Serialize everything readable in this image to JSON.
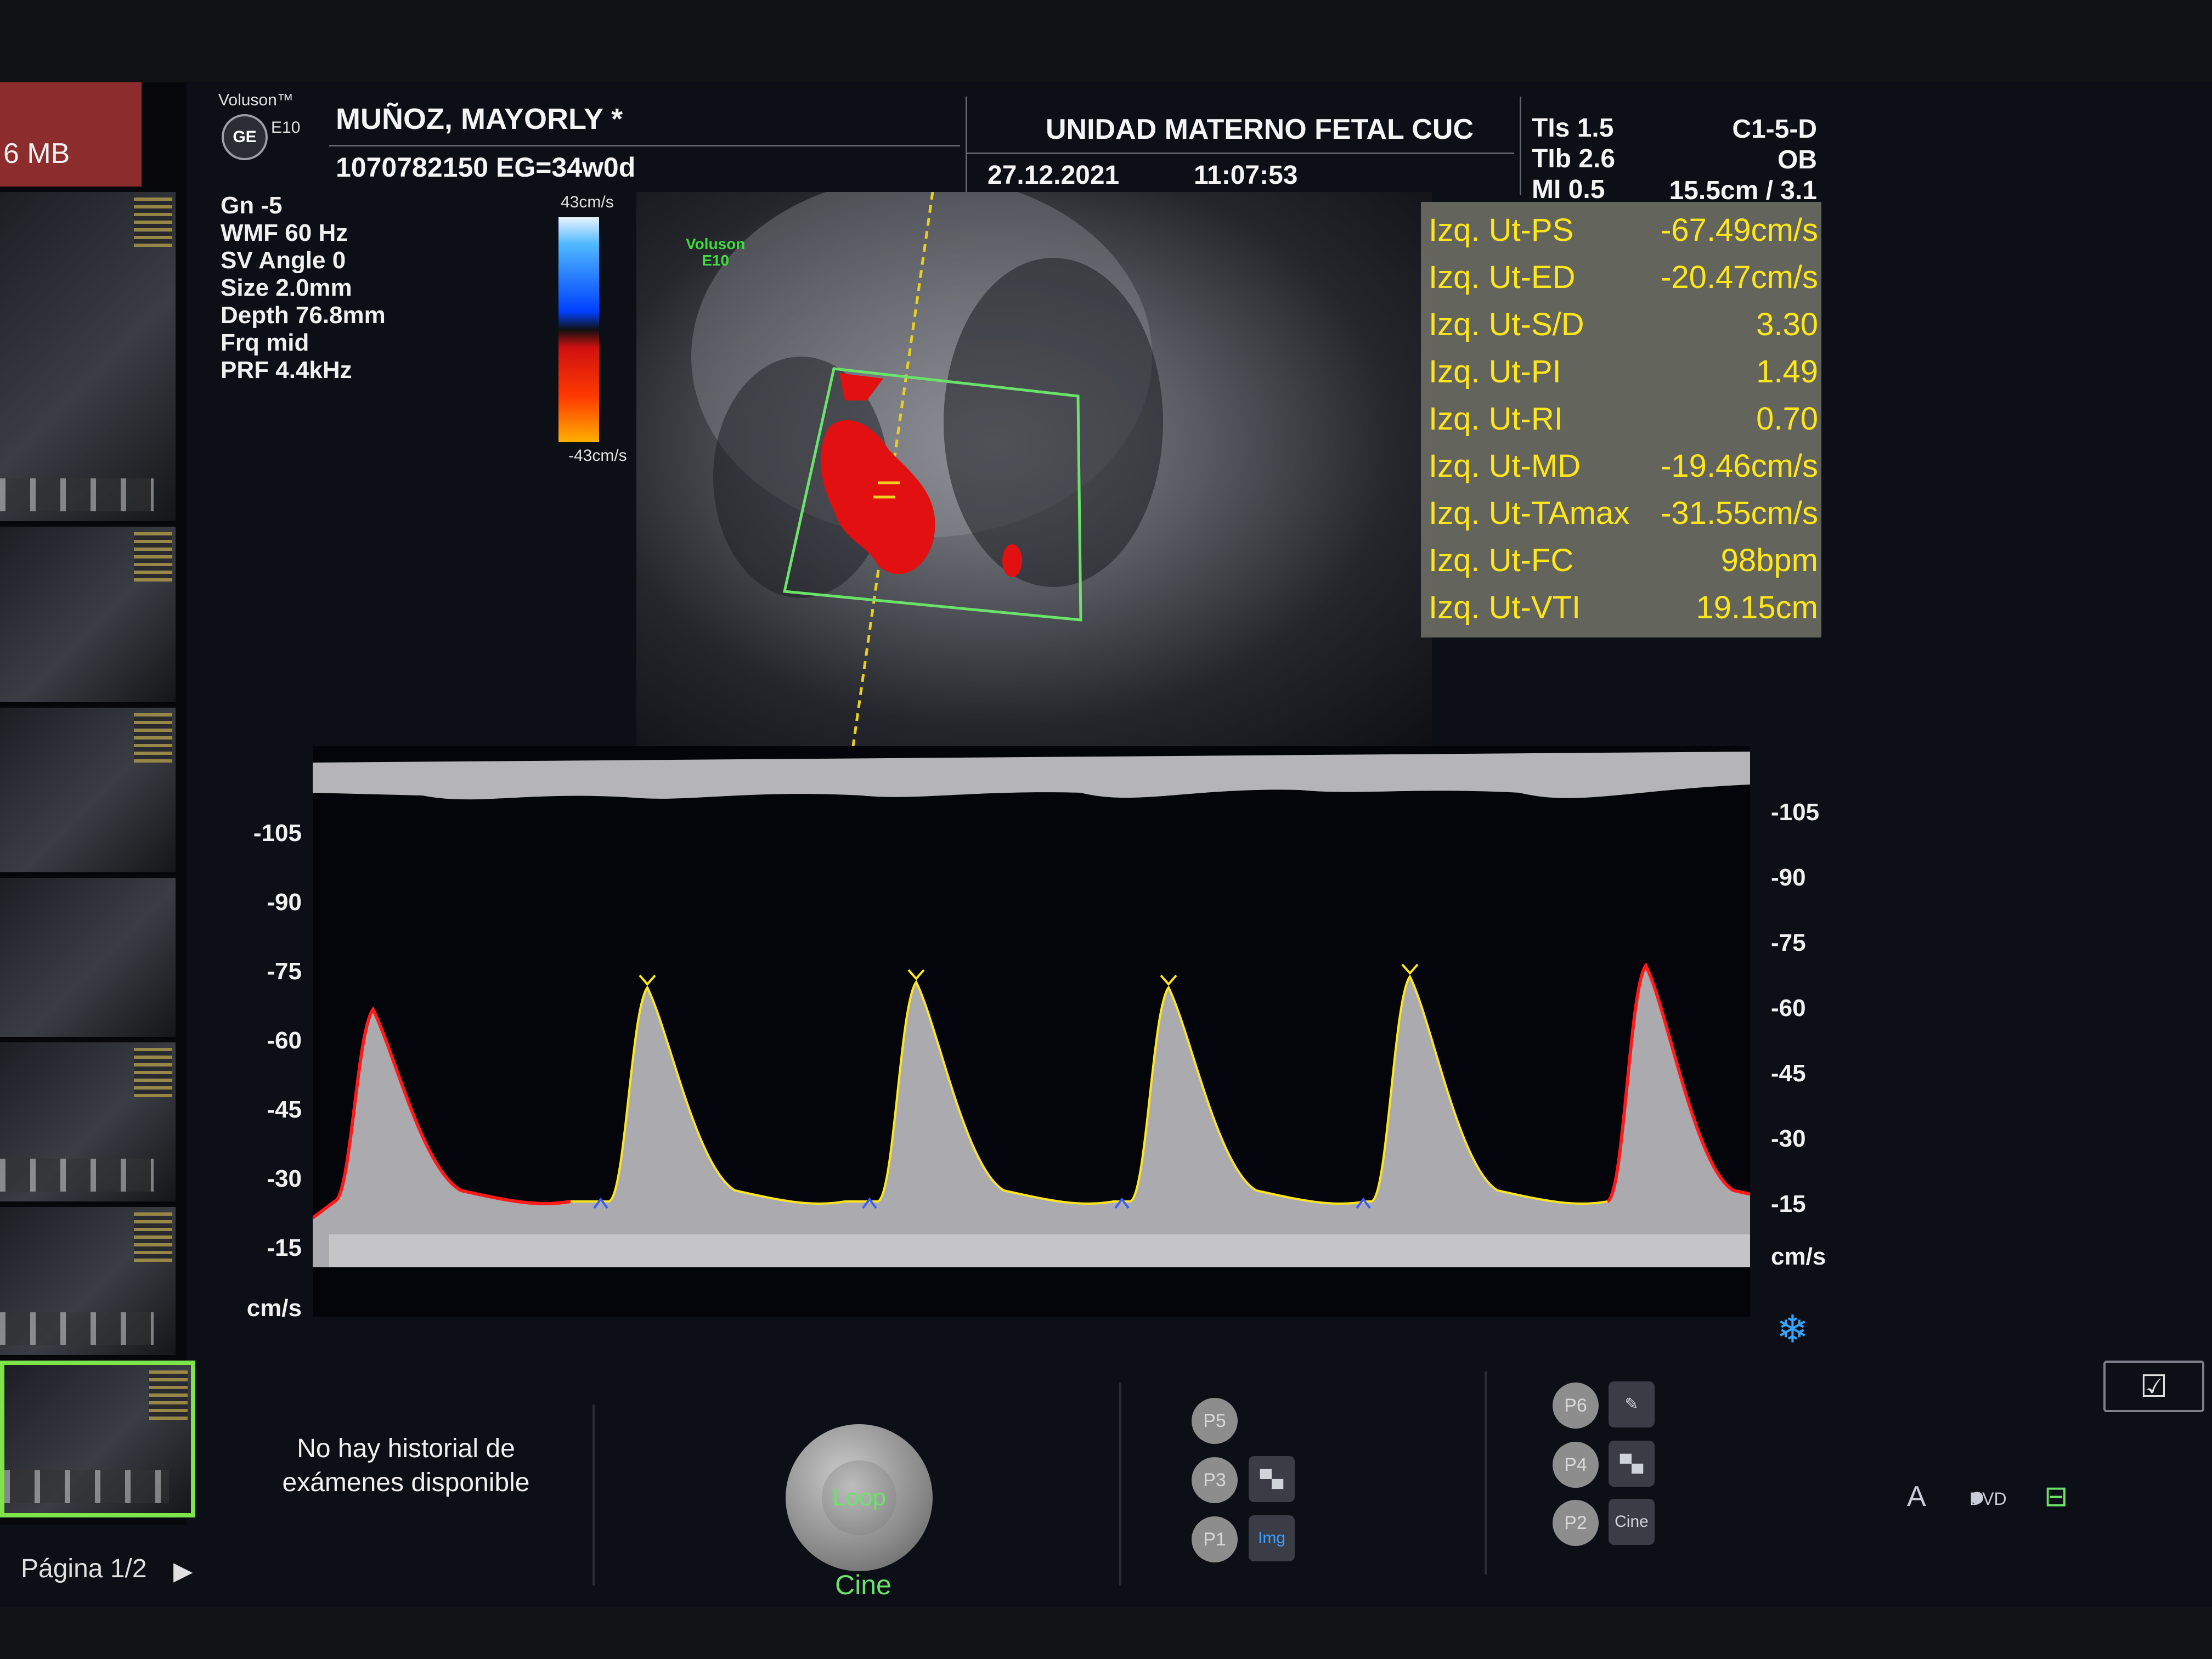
{
  "header": {
    "brand": "Voluson™",
    "logo_text": "GE",
    "model": "E10",
    "patient_name": "MUÑOZ, MAYORLY  *",
    "patient_id": "1070782150   EG=34w0d",
    "institution": "UNIDAD MATERNO FETAL CUC",
    "date": "27.12.2021",
    "time": "11:07:53",
    "thermal": [
      "TIs   1.5",
      "TIb   2.6",
      "MI   0.5"
    ],
    "probe_lines": [
      "C1-5-D",
      "OB",
      "15.5cm / 3.1"
    ]
  },
  "sidebar": {
    "size_label": "6 MB",
    "page_label": "Página 1/2",
    "page_arrow_icon": "triangle-right-icon"
  },
  "params": [
    "Gn  -5",
    "WMF 60 Hz",
    "SV Angle  0",
    "Size  2.0mm",
    "Depth 76.8mm",
    "Frq mid",
    "PRF  4.4kHz"
  ],
  "color_scale": {
    "top": "43cm/s",
    "bottom": "-43cm/s"
  },
  "image_logo": {
    "line1": "Voluson",
    "line2": "E10"
  },
  "measurements": [
    {
      "label": "Izq. Ut-PS",
      "value": "-67.49cm/s"
    },
    {
      "label": "Izq. Ut-ED",
      "value": "-20.47cm/s"
    },
    {
      "label": "Izq. Ut-S/D",
      "value": "3.30"
    },
    {
      "label": "Izq. Ut-PI",
      "value": "1.49"
    },
    {
      "label": "Izq. Ut-RI",
      "value": "0.70"
    },
    {
      "label": "Izq. Ut-MD",
      "value": "-19.46cm/s"
    },
    {
      "label": "Izq. Ut-TAmax",
      "value": "-31.55cm/s"
    },
    {
      "label": "Izq. Ut-FC",
      "value": "98bpm"
    },
    {
      "label": "Izq. Ut-VTI",
      "value": "19.15cm"
    }
  ],
  "doppler": {
    "left_ticks": [
      "-105",
      "-90",
      "-75",
      "-60",
      "-45",
      "-30",
      "-15"
    ],
    "right_ticks": [
      "-105",
      "-90",
      "-75",
      "-60",
      "-45",
      "-30",
      "-15"
    ],
    "unit": "cm/s"
  },
  "bottom": {
    "no_history": "No hay historial de exámenes disponible",
    "loop_label": "Loop",
    "cine_label": "Cine",
    "presets": [
      "P5",
      "P3",
      "P1",
      "P6",
      "P4",
      "P2"
    ],
    "img_label": "Img",
    "cine_btn_label": "Cine",
    "freeze_icon": "snowflake-icon",
    "checkbox_icon": "checkbox-icon",
    "a_label": "A",
    "dvd_label": "DVD"
  },
  "colors": {
    "trace_red": "#ff1a1a",
    "trace_yellow": "#ffe61c",
    "measure_text": "#ffe61c",
    "roi_green": "#6be36b"
  }
}
